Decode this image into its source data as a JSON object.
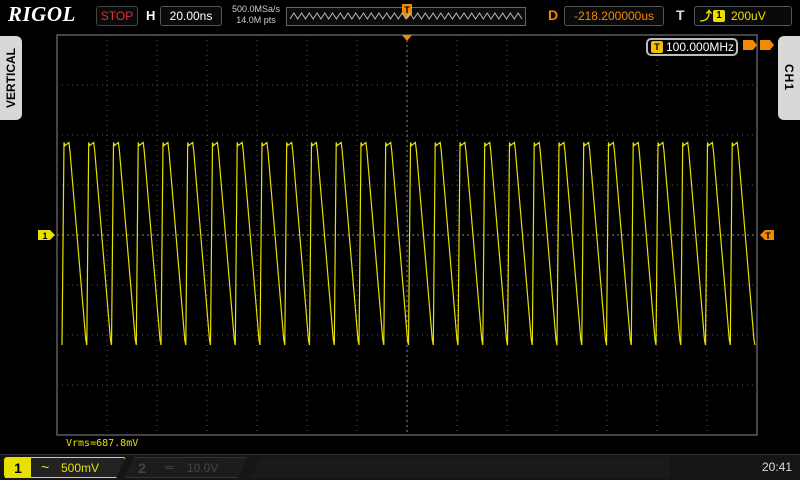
{
  "brand": "RIGOL",
  "run_state": "STOP",
  "horizontal": {
    "letter": "H",
    "timebase": "20.00ns"
  },
  "acquisition": {
    "sample_rate": "500.0MSa/s",
    "memory_depth": "14.0M pts"
  },
  "delay": {
    "letter": "D",
    "value": "-218.200000us"
  },
  "trigger": {
    "letter": "T",
    "level": "200uV",
    "frequency": "100.000MHz",
    "source_badge": "1",
    "marker": "T"
  },
  "left_tab": "VERTICAL",
  "right_tab": "CH1",
  "measurement": "Vrms=687.8mV",
  "channel1": {
    "number": "1",
    "coupling_symbol": "~",
    "scale": "500mV"
  },
  "channel2": {
    "number": "2",
    "coupling_symbol": "═",
    "scale": "10.0V"
  },
  "clock": "20:41",
  "colors": {
    "ch1": "#e8e000",
    "accent": "#f08a00",
    "grid": "#666666",
    "state_red": "#e03030"
  },
  "waveform": {
    "cycles": 28,
    "high_level": 1.85,
    "low_level": -2.1,
    "unit": "div"
  }
}
